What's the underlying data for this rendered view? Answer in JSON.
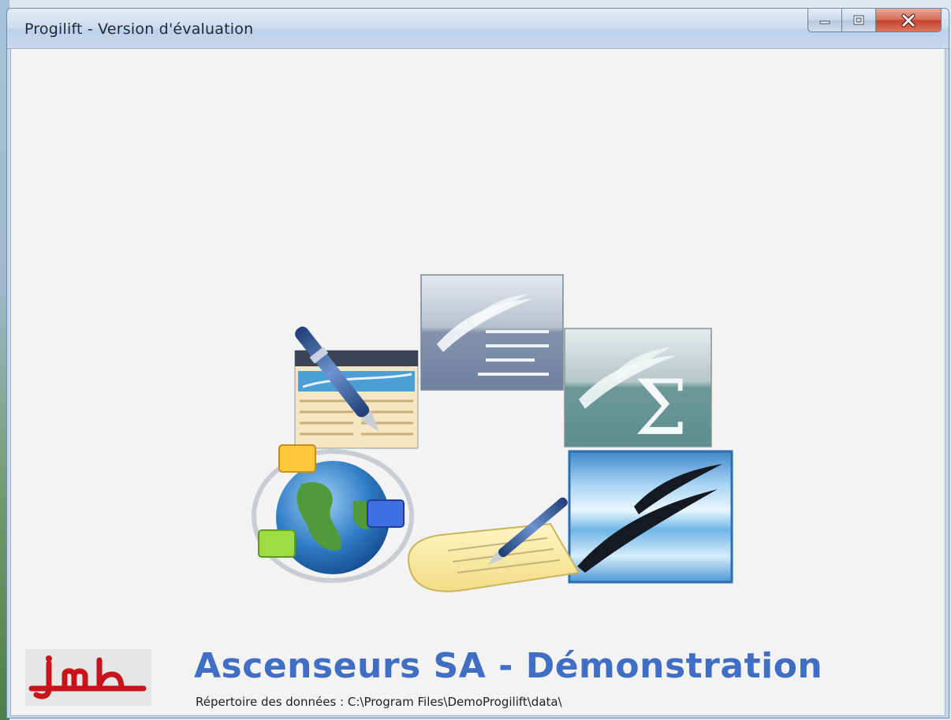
{
  "window": {
    "title": "Progilift - Version d'évaluation",
    "buttons": {
      "minimize_icon": "minimize-icon",
      "maximize_icon": "maximize-icon",
      "close_icon": "close-icon"
    }
  },
  "splash": {
    "heading": "Ascenseurs SA - Démonstration",
    "data_path_text": "Répertoire des données : C:\\Program Files\\DemoProgilift\\data\\",
    "logo_text": "jmb",
    "logo_color": "#c8151b",
    "heading_color": "#3f6ec4",
    "icons": [
      "form-pen-icon",
      "writer-document-icon",
      "calc-spreadsheet-icon",
      "openoffice-gull-icon",
      "network-globe-icon",
      "notepad-pen-icon"
    ]
  }
}
